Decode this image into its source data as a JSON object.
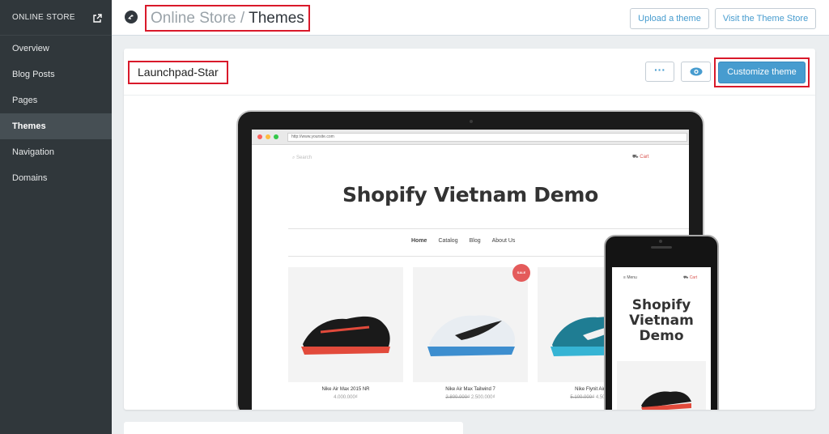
{
  "sidebar": {
    "title": "ONLINE STORE",
    "items": [
      {
        "label": "Overview"
      },
      {
        "label": "Blog Posts"
      },
      {
        "label": "Pages"
      },
      {
        "label": "Themes"
      },
      {
        "label": "Navigation"
      },
      {
        "label": "Domains"
      }
    ],
    "active": "Themes"
  },
  "header": {
    "crumb_parent": "Online Store",
    "crumb_sep": "/",
    "crumb_current": "Themes",
    "upload_label": "Upload a theme",
    "store_label": "Visit the Theme Store"
  },
  "theme": {
    "name": "Launchpad-Star",
    "more_label": "···",
    "customize_label": "Customize theme"
  },
  "preview": {
    "url": "http://www.yoursite.com",
    "search_placeholder": "Search",
    "cart_label": "Cart",
    "site_title": "Shopify Vietnam Demo",
    "nav": [
      "Home",
      "Catalog",
      "Blog",
      "About Us"
    ],
    "sale_badge": "SALE",
    "products": [
      {
        "name": "Nike Air Max 2015 NR",
        "price": "4.000.000₫"
      },
      {
        "name": "Nike Air Max Tailwind 7",
        "price_old": "2.800.000₫",
        "price": "2.500.000₫"
      },
      {
        "name": "Nike Flynit Air Max",
        "price_old": "5.100.000₫",
        "price": "4.500.000₫"
      }
    ],
    "phone_menu": "Menu",
    "phone_cart": "Cart",
    "phone_title_lines": [
      "Shopify",
      "Vietnam",
      "Demo"
    ]
  },
  "colors": {
    "sidebar_bg": "#30373b",
    "accent": "#479ccf",
    "highlight_box": "#d9192a"
  }
}
